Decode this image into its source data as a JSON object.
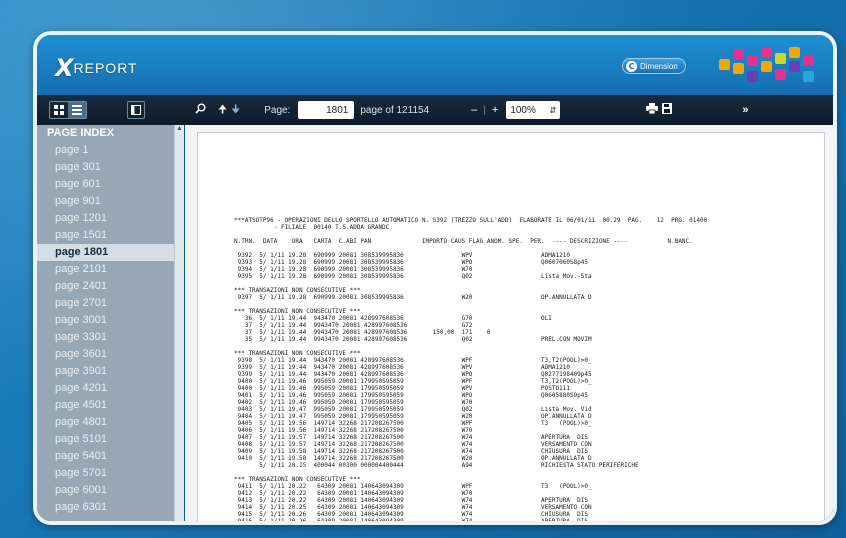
{
  "app": {
    "logo_text": "REPORT",
    "badge_text": "Dimension"
  },
  "toolbar": {
    "page_label": "Page:",
    "page_value": "1801",
    "page_of": "page of 121154",
    "zoom_value": "100%"
  },
  "sidebar": {
    "title": "PAGE INDEX",
    "items": [
      "page 1",
      "page 301",
      "page 601",
      "page 901",
      "page 1201",
      "page 1501",
      "page 1801",
      "page 2101",
      "page 2401",
      "page 2701",
      "page 3001",
      "page 3301",
      "page 3601",
      "page 3901",
      "page 4201",
      "page 4501",
      "page 4801",
      "page 5101",
      "page 5401",
      "page 5701",
      "page 6001",
      "page 6301"
    ],
    "active_index": 6
  },
  "document": {
    "lines": [
      "***ATSOTP96 - OPERAZIONI DELLO SPORTELLO AUTOMATICO N. 5392 (TREZZO SULL'ADD)  ELABORATE IL 06/01/11  00.29  PAG.    12  PRG. 01400",
      "           - FILIALE  00140 T.S.ADDA GRANDC",
      "",
      "N.TRN.  DATA    ORA   CARTA  C.ABI PAN              IMPORTO CAUS FLAG ANOM. SPE.  PER.  ---- DESCRIZIONE ----           N.BANC.",
      "",
      " 9392  5/ 1/11 19.28  690999 20081 308539995836                WPV                   ADMA1210",
      " 9393  5/ 1/11 19.28  690999 20081 308539995836                WPO                   Q0607060S8p45",
      " 9394  5/ 1/11 19.28  690999 20081 308539995836                W70",
      " 9395  5/ 1/11 19.28  690999 20081 308539995836                Q02                   Lista Mov.-Sta",
      "",
      "*** TRANSAZIONI NON CONSECUTIVE ***",
      " 9397  5/ 1/11 19.28  690999 20081 308539995836                W20                   OP.ANNULLATA D",
      "",
      "*** TRANSAZIONI NON CONSECUTIVE ***",
      "   36  5/ 1/11 19.44  943470 20081 428997608536                G70                   OLI",
      "   37  5/ 1/11 19.44  9943470 20081 428997608536               G72",
      "   37  5/ 1/11 19.44  9943470 20081 428997608536       150,00  171    0",
      "   35  5/ 1/11 19.44  9943470 20081 428997608536               Q02                   PREL.CON MOVIM",
      "",
      "*** TRANSAZIONI NON CONSECUTIVE ***",
      " 9398  5/ 1/11 19.44  943470 20081 428997608536                WPF                   T3,T2(POOL)>0_",
      " 9399  5/ 1/11 19.44  943470 20081 428997608536                WPV                   ADMA1210",
      " 9399  5/ 1/11 19.44  943470 20081 428997608536                WPO                   Q0277198409p45",
      " 9400  5/ 1/11 19.46  995059 20081 179950595059                WPF                   T3,T2(POOL)>0_",
      " 9400  5/ 1/11 19.46  995059 20081 179950595059                WPV                   POSTO111",
      " 9401  5/ 1/11 19.46  995059 20081 179950595059                WPO                   Q0605880S9p45",
      " 9402  5/ 1/11 19.46  995059 20081 179950595059                W70",
      " 9403  5/ 1/11 19.47  995059 20081 179950595059                Q02                   Lista Mov. Vid",
      " 9404  5/ 1/11 19.47  995059 20081 179950595059                W20                   OP.ANNULLATA D",
      " 9405  5/ 1/11 19.56  149714 32268 217208267500                WPF                   T3   (POOL)>0_",
      " 9406  5/ 1/11 19.56  149714 32268 217208267500                W70",
      " 9407  5/ 1/11 19.57  149714 32268 217208267500                W74                   APERTURA  DIS",
      " 9408  5/ 1/11 19.57  149714 32268 217208267500                W74                   VERSAMENTO CON",
      " 9409  5/ 1/11 19.58  149714 32268 217208267500                W74                   CHIUSURA  DIS",
      " 9410  5/ 1/11 19.58  149714 32268 217208267500                W20                   OP.ANNULLATA D",
      "       5/ 1/11 20.15  400044 00300 000004400444                A94                   RICHIESTA STATO PERIFERICHE",
      "",
      "*** TRANSAZIONI NON CONSECUTIVE ***",
      " 9411  5/ 1/11 20.22   64309 20081 140643094309                WPF                   T3   (POOL)>0_",
      " 9412  5/ 1/11 20.22   64309 20081 140643094309                W70",
      " 9413  5/ 1/11 20.22   64309 20081 140643094309                W74                   APERTURA  DIS",
      " 9414  5/ 1/11 20.25   64309 20081 140643094309                W74                   VERSAMENTO CON",
      " 9415  5/ 1/11 20.26   64309 20081 140643094309                W74                   CHIUSURA  DIS",
      " 9416  5/ 1/11 20.26   64309 20081 140643094309                W74                   APERTURA  DIS"
    ]
  }
}
